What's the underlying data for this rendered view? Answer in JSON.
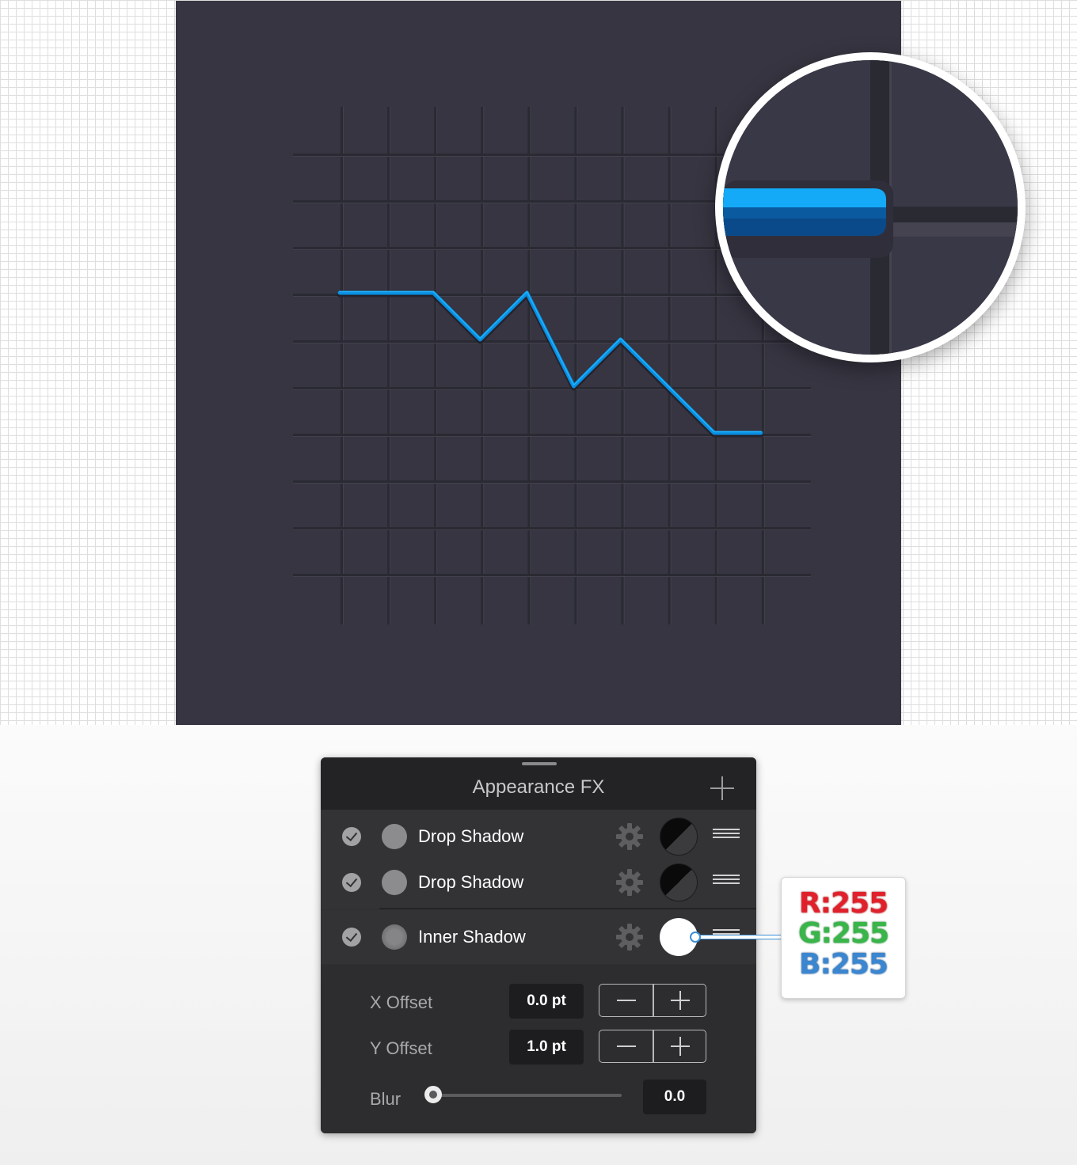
{
  "panel": {
    "title": "Appearance FX",
    "add_icon": "plus-icon",
    "effects": [
      {
        "enabled": true,
        "label": "Drop Shadow",
        "color": "#000000"
      },
      {
        "enabled": true,
        "label": "Drop Shadow",
        "color": "#000000"
      },
      {
        "enabled": true,
        "label": "Inner Shadow",
        "color": "#ffffff"
      }
    ],
    "settings": {
      "x_offset_label": "X Offset",
      "x_offset_value": "0.0 pt",
      "y_offset_label": "Y Offset",
      "y_offset_value": "1.0 pt",
      "blur_label": "Blur",
      "blur_value": "0.0",
      "blur_slider_fraction": 0
    }
  },
  "callout": {
    "r": "R:255",
    "g": "G:255",
    "b": "B:255"
  },
  "chart_data": {
    "type": "line",
    "x": [
      0,
      1,
      2,
      3,
      4,
      5,
      6,
      7,
      8,
      9
    ],
    "y": [
      7,
      7,
      7,
      6,
      7,
      5,
      6,
      5,
      4,
      4
    ],
    "grid": true,
    "grid_columns": 9,
    "grid_rows": 10,
    "line_color": "#0a8ee0"
  },
  "colors": {
    "artboard": "#363541",
    "panel_bg": "#2f2f31",
    "line_blue": "#0a8ee0",
    "highlight_blue": "#16b0ff"
  }
}
